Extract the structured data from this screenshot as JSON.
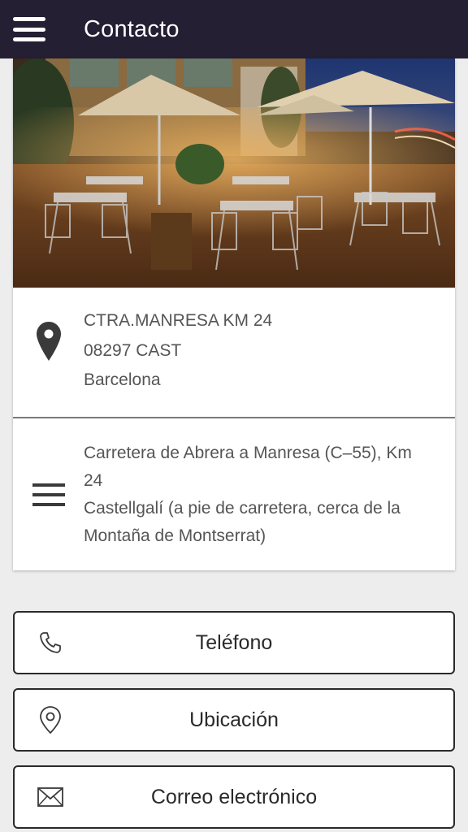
{
  "header": {
    "menu_icon": "hamburger-menu-icon",
    "title": "Contacto"
  },
  "colors": {
    "appbar": "#241f33",
    "background": "#ededed",
    "text": "#555555"
  },
  "contact_card": {
    "photo_alt": "restaurant terrace",
    "address": {
      "icon": "map-pin-icon",
      "line1": "CTRA.MANRESA KM 24",
      "line2": "08297 CAST",
      "line3": "Barcelona"
    },
    "description": {
      "icon": "menu-lines-icon",
      "line1": "Carretera de Abrera a Manresa (C–55), Km",
      "line2": "24",
      "line3": "Castellgalí (a pie de carretera, cerca de la",
      "line4": "Montaña de Montserrat)"
    }
  },
  "actions": {
    "phone": {
      "label": "Teléfono",
      "icon": "phone-icon"
    },
    "location": {
      "label": "Ubicación",
      "icon": "location-pin-icon"
    },
    "email": {
      "label": "Correo electrónico",
      "icon": "envelope-icon"
    }
  }
}
